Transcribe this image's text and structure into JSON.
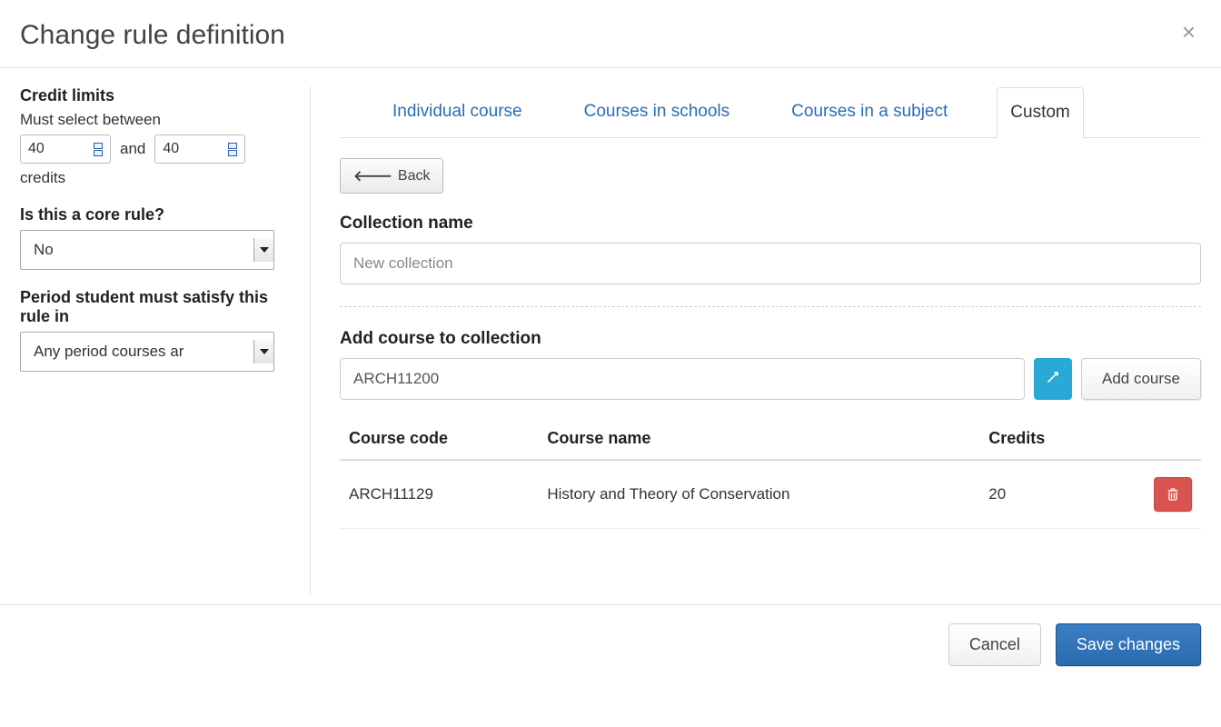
{
  "modal": {
    "title": "Change rule definition"
  },
  "sidebar": {
    "credit_limits_heading": "Credit limits",
    "must_select_label": "Must select between",
    "min_credits": "40",
    "and_text": "and",
    "max_credits": "40",
    "credits_word": "credits",
    "core_rule_label": "Is this a core rule?",
    "core_rule_value": "No",
    "period_label": "Period student must satisfy this rule in",
    "period_value": "Any period courses ar"
  },
  "tabs": {
    "items": [
      {
        "label": "Individual course",
        "active": false
      },
      {
        "label": "Courses in schools",
        "active": false
      },
      {
        "label": "Courses in a subject",
        "active": false
      },
      {
        "label": "Custom",
        "active": true
      }
    ]
  },
  "main": {
    "back_label": "Back",
    "collection_name_label": "Collection name",
    "collection_name_placeholder": "New collection",
    "add_course_label": "Add course to collection",
    "course_search_value": "ARCH11200",
    "pick_icon": "pick-icon",
    "add_course_button": "Add course"
  },
  "table": {
    "headers": {
      "code": "Course code",
      "name": "Course name",
      "credits": "Credits"
    },
    "rows": [
      {
        "code": "ARCH11129",
        "name": "History and Theory of Conservation",
        "credits": "20"
      }
    ]
  },
  "footer": {
    "cancel": "Cancel",
    "save": "Save changes"
  }
}
